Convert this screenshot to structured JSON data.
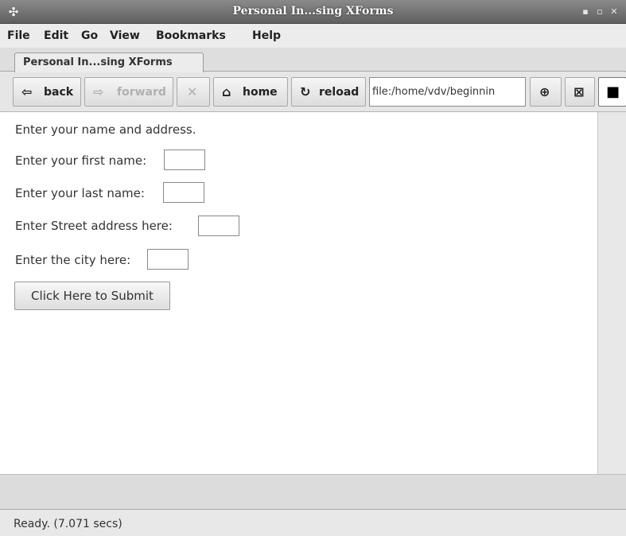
{
  "window": {
    "title": "Personal In...sing XForms"
  },
  "titlebar_icons": {
    "sysmenu": "app-menu-icon",
    "minimize": "minimize-icon",
    "maximize": "maximize-icon",
    "close": "close-icon"
  },
  "menu": [
    "File",
    "Edit",
    "Go",
    "View",
    "Bookmarks",
    "Help"
  ],
  "tabs": [
    {
      "label": "Personal In...sing XForms"
    }
  ],
  "toolbar": {
    "back": "back",
    "forward": "forward",
    "home": "home",
    "reload": "reload",
    "url": "file:/home/vdv/beginnin"
  },
  "form": {
    "intro": "Enter your name and address.",
    "first_name_label": "Enter your first name:",
    "last_name_label": "Enter your last name:",
    "street_label": "Enter Street address here:",
    "city_label": "Enter the city here:",
    "submit_label": "Click Here to Submit"
  },
  "status": {
    "text": "Ready. (7.071 secs)"
  }
}
